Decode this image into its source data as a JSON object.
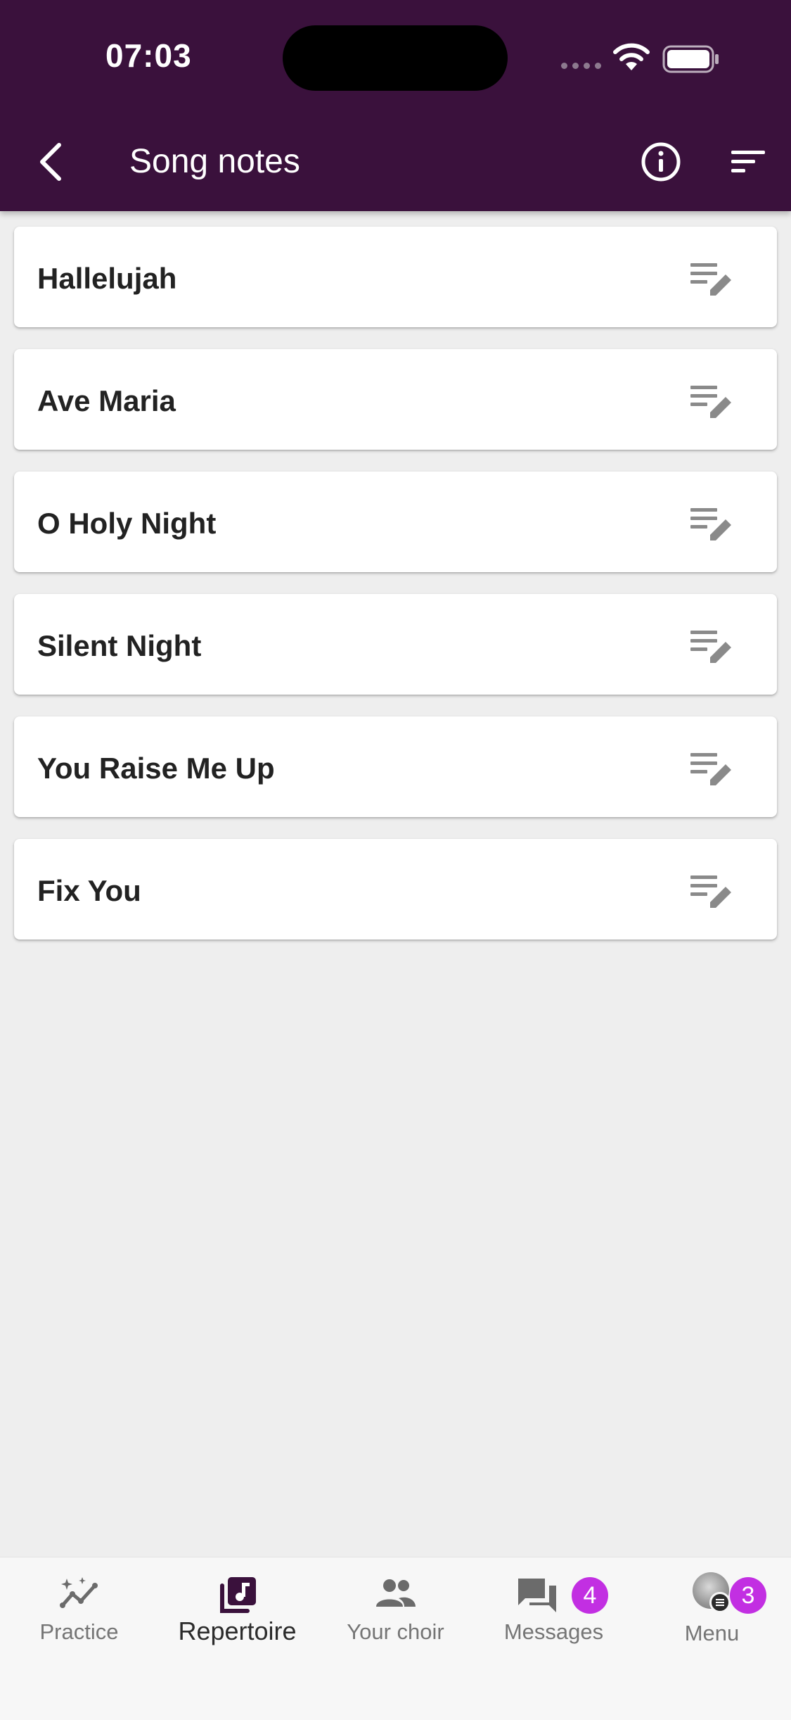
{
  "status_bar": {
    "time": "07:03"
  },
  "toolbar": {
    "title": "Song notes",
    "back_icon": "chevron-left-icon",
    "info_icon": "info-icon",
    "sort_icon": "sort-icon"
  },
  "songs": [
    {
      "title": "Hallelujah",
      "icon": "edit-notes-icon"
    },
    {
      "title": "Ave Maria",
      "icon": "edit-notes-icon"
    },
    {
      "title": "O Holy Night",
      "icon": "edit-notes-icon"
    },
    {
      "title": "Silent Night",
      "icon": "edit-notes-icon"
    },
    {
      "title": "You Raise Me Up",
      "icon": "edit-notes-icon"
    },
    {
      "title": "Fix You",
      "icon": "edit-notes-icon"
    }
  ],
  "bottom_nav": {
    "items": [
      {
        "label": "Practice",
        "icon": "sparkle-chart-icon"
      },
      {
        "label": "Repertoire",
        "icon": "music-library-icon",
        "active": true
      },
      {
        "label": "Your choir",
        "icon": "people-icon"
      },
      {
        "label": "Messages",
        "icon": "chat-icon",
        "badge": "4"
      },
      {
        "label": "Menu",
        "icon": "avatar",
        "badge": "3"
      }
    ]
  },
  "colors": {
    "header_bg": "#3a113c",
    "badge": "#c22fe2",
    "background": "#eeeeee"
  }
}
